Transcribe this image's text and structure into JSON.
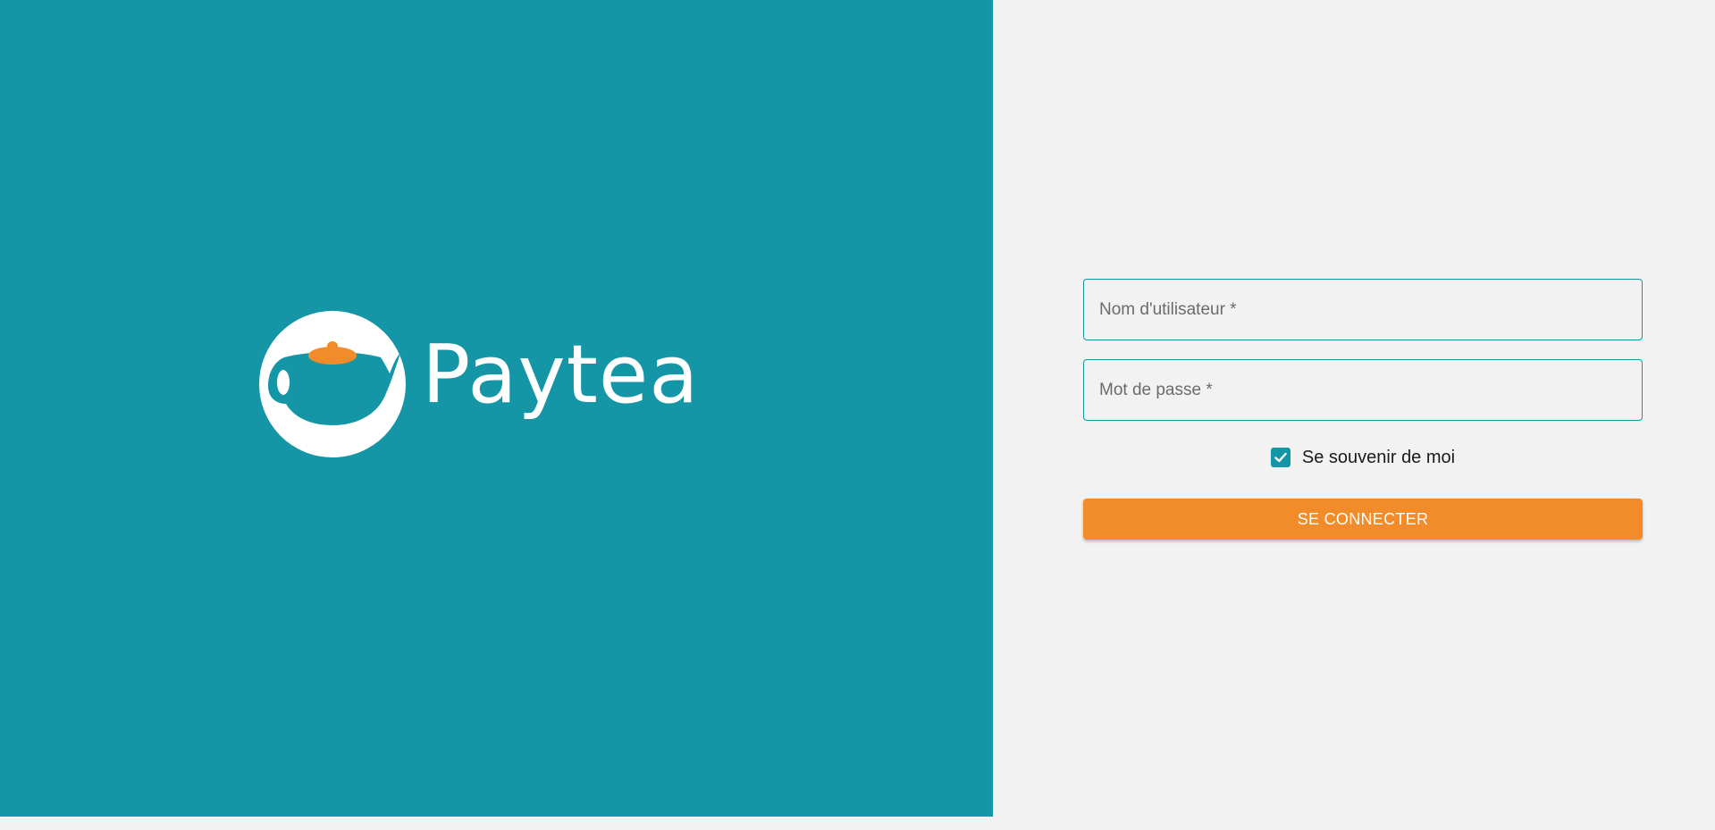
{
  "brand": {
    "name": "Paytea",
    "logo_icon": "teapot-icon",
    "background_color": "#1596a7",
    "accent_color": "#f28b2a"
  },
  "login_form": {
    "username_label": "Nom d'utilisateur *",
    "username_value": "",
    "password_label": "Mot de passe *",
    "password_value": "",
    "remember_label": "Se souvenir de moi",
    "remember_checked": true,
    "submit_label": "SE CONNECTER"
  }
}
